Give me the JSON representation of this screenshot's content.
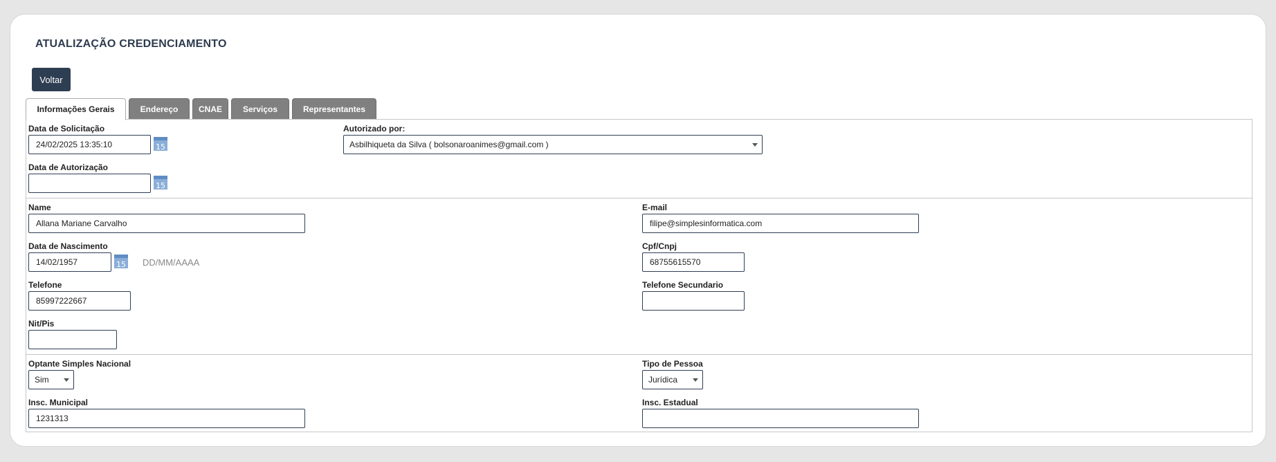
{
  "page": {
    "title": "ATUALIZAÇÃO CREDENCIAMENTO",
    "back_label": "Voltar"
  },
  "tabs": [
    {
      "label": "Informações Gerais",
      "active": true
    },
    {
      "label": "Endereço",
      "active": false
    },
    {
      "label": "CNAE",
      "active": false
    },
    {
      "label": "Serviços",
      "active": false
    },
    {
      "label": "Representantes",
      "active": false
    }
  ],
  "form": {
    "solicitacao": {
      "label": "Data de Solicitação",
      "value": "24/02/2025 13:35:10"
    },
    "autorizado": {
      "label": "Autorizado por:",
      "value": "Asbilhiqueta da Silva ( bolsonaroanimes@gmail.com )"
    },
    "autorizacao": {
      "label": "Data de Autorização",
      "value": ""
    },
    "name": {
      "label": "Name",
      "value": "Allana Mariane Carvalho"
    },
    "email": {
      "label": "E-mail",
      "value": "filipe@simplesinformatica.com"
    },
    "nascimento": {
      "label": "Data de Nascimento",
      "value": "14/02/1957",
      "hint": "DD/MM/AAAA"
    },
    "cpf": {
      "label": "Cpf/Cnpj",
      "value": "68755615570"
    },
    "telefone": {
      "label": "Telefone",
      "value": "85997222667"
    },
    "telefone2": {
      "label": "Telefone Secundario",
      "value": ""
    },
    "nit": {
      "label": "Nit/Pis",
      "value": ""
    },
    "simples": {
      "label": "Optante Simples Nacional",
      "value": "Sim"
    },
    "tipo_pessoa": {
      "label": "Tipo de Pessoa",
      "value": "Jurídica"
    },
    "insc_municipal": {
      "label": "Insc. Municipal",
      "value": "1231313"
    },
    "insc_estadual": {
      "label": "Insc. Estadual",
      "value": ""
    }
  },
  "calendar_icon": {
    "name": "calendar-icon",
    "day": "15"
  },
  "colors": {
    "primary": "#2e3e52",
    "tab_inactive": "#808080",
    "calendar": "#8aaed8"
  }
}
